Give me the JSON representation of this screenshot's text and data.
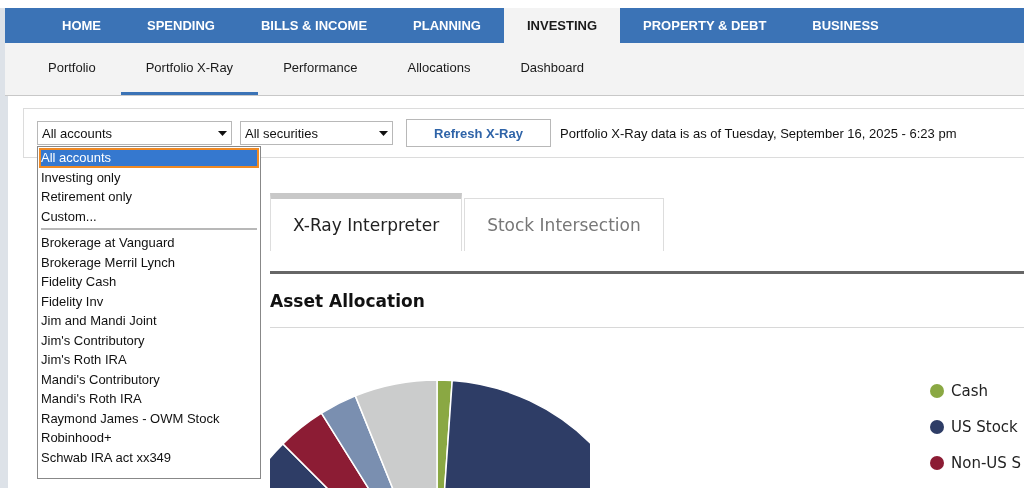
{
  "nav_tabs": [
    {
      "label": "HOME",
      "selected": false
    },
    {
      "label": "SPENDING",
      "selected": false
    },
    {
      "label": "BILLS & INCOME",
      "selected": false
    },
    {
      "label": "PLANNING",
      "selected": false
    },
    {
      "label": "INVESTING",
      "selected": true
    },
    {
      "label": "PROPERTY & DEBT",
      "selected": false
    },
    {
      "label": "BUSINESS",
      "selected": false
    }
  ],
  "sub_tabs": [
    {
      "label": "Portfolio",
      "selected": false
    },
    {
      "label": "Portfolio X-Ray",
      "selected": true
    },
    {
      "label": "Performance",
      "selected": false
    },
    {
      "label": "Allocations",
      "selected": false
    },
    {
      "label": "Dashboard",
      "selected": false
    }
  ],
  "toolbar": {
    "account_select": {
      "value": "All accounts",
      "expanded": true
    },
    "securities_select": {
      "value": "All securities"
    },
    "refresh_button": "Refresh X-Ray",
    "as_of_text": "Portfolio X-Ray data is as of Tuesday, September 16, 2025 - 6:23 pm"
  },
  "account_dropdown": {
    "groups": [
      [
        {
          "label": "All accounts",
          "selected": true
        },
        {
          "label": "Investing only",
          "selected": false
        },
        {
          "label": "Retirement only",
          "selected": false
        },
        {
          "label": "Custom...",
          "selected": false
        }
      ],
      [
        {
          "label": "Brokerage at Vanguard",
          "selected": false
        },
        {
          "label": "Brokerage Merril Lynch",
          "selected": false
        },
        {
          "label": "Fidelity Cash",
          "selected": false
        },
        {
          "label": "Fidelity Inv",
          "selected": false
        },
        {
          "label": "Jim and Mandi Joint",
          "selected": false
        },
        {
          "label": "Jim's Contributory",
          "selected": false
        },
        {
          "label": "Jim's Roth IRA",
          "selected": false
        },
        {
          "label": "Mandi's Contributory",
          "selected": false
        },
        {
          "label": "Mandi's Roth IRA",
          "selected": false
        },
        {
          "label": "Raymond James - OWM Stock",
          "selected": false
        },
        {
          "label": "Robinhood+",
          "selected": false
        },
        {
          "label": "Schwab IRA act xx349",
          "selected": false
        }
      ]
    ]
  },
  "content_tabs": [
    {
      "label": "X-Ray Interpreter",
      "selected": true
    },
    {
      "label": "Stock Intersection",
      "selected": false
    }
  ],
  "section_title": "Asset Allocation",
  "legend": [
    {
      "label": "Cash",
      "color": "#8aa843"
    },
    {
      "label": "US Stock",
      "color": "#2e3d66"
    },
    {
      "label": "Non-US S",
      "color": "#8c1c34"
    }
  ]
}
